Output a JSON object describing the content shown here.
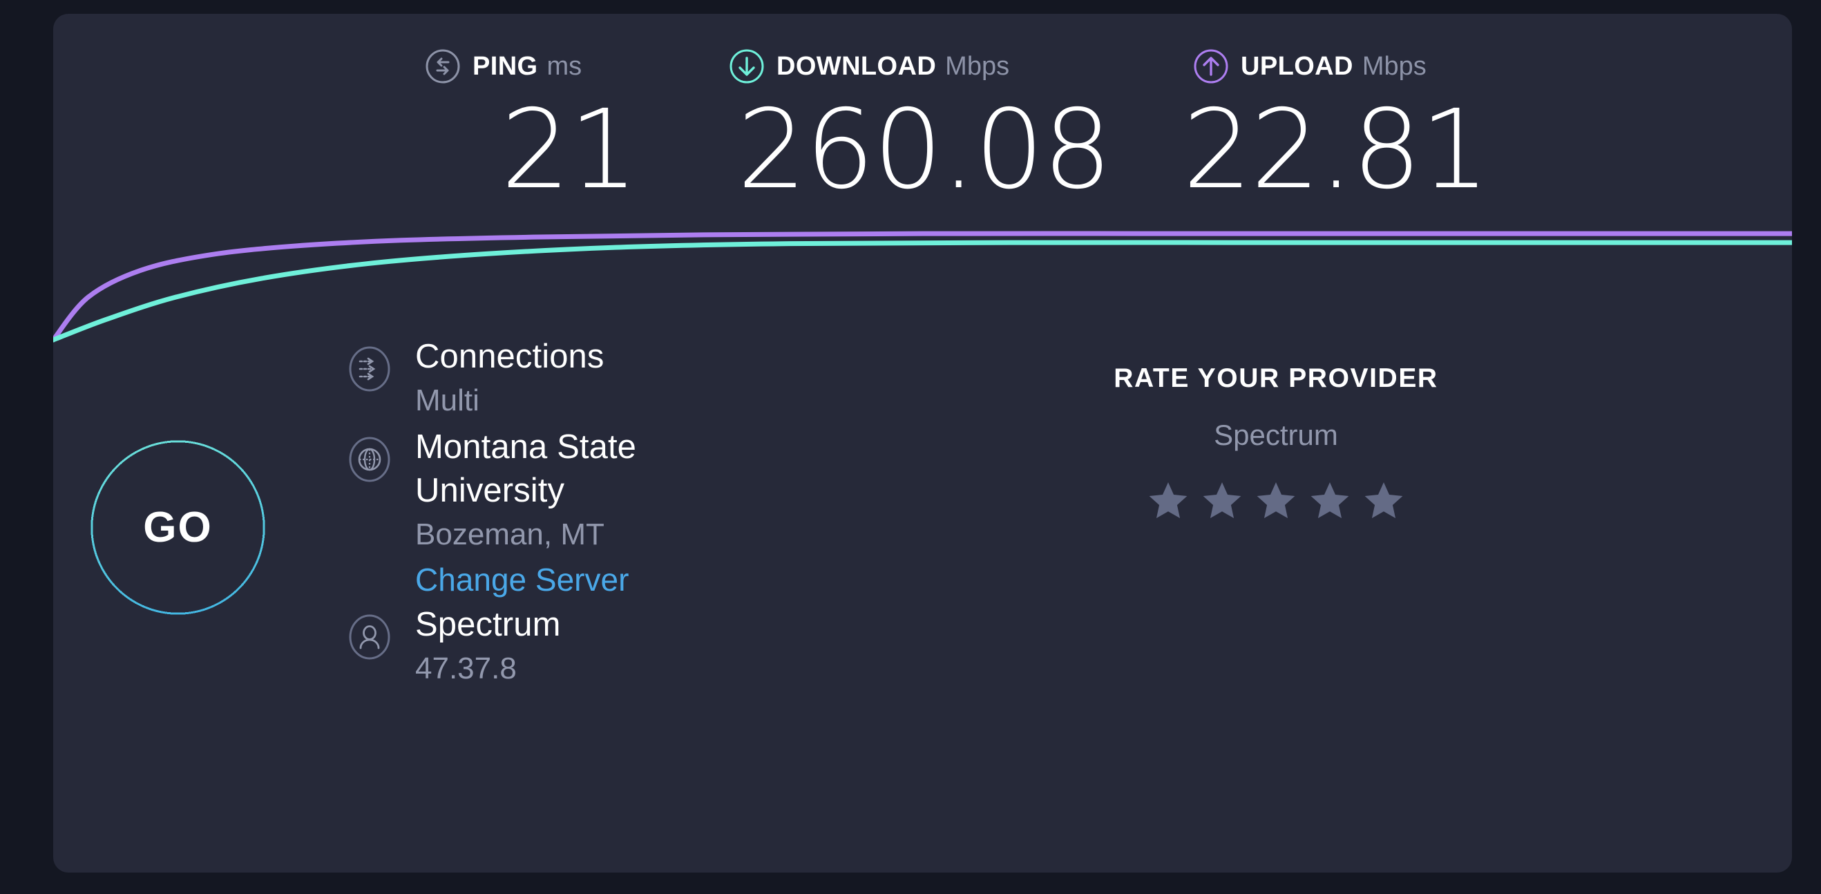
{
  "metrics": [
    {
      "id": "ping",
      "icon": "ping-icon",
      "label": "PING",
      "unit": "ms",
      "value": "21",
      "accent": "#8d93a8"
    },
    {
      "id": "download",
      "icon": "download-icon",
      "label": "DOWNLOAD",
      "unit": "Mbps",
      "value": "260.08",
      "accent": "#6ff0da"
    },
    {
      "id": "upload",
      "icon": "upload-icon",
      "label": "UPLOAD",
      "unit": "Mbps",
      "value": "22.81",
      "accent": "#ad7ef0"
    }
  ],
  "go_button": {
    "label": "GO"
  },
  "info": {
    "connections": {
      "icon": "connections-icon",
      "primary": "Connections",
      "secondary": "Multi"
    },
    "server": {
      "icon": "globe-icon",
      "primary_line1": "Montana State",
      "primary_line2": "University",
      "secondary": "Bozeman, MT",
      "change_link": "Change Server"
    },
    "isp": {
      "icon": "person-icon",
      "primary": "Spectrum",
      "secondary": "47.37.8"
    }
  },
  "rating": {
    "title": "RATE YOUR PROVIDER",
    "provider": "Spectrum",
    "stars_total": 5,
    "stars_filled": 0,
    "star_color": "#646b86"
  },
  "chart_data": {
    "type": "line",
    "title": "",
    "xlabel": "",
    "ylabel": "",
    "series": [
      {
        "name": "upload",
        "color": "#ad7ef0",
        "points": [
          [
            0,
            0
          ],
          [
            2,
            38
          ],
          [
            5,
            62
          ],
          [
            9,
            76
          ],
          [
            14,
            84
          ],
          [
            20,
            89
          ],
          [
            28,
            92
          ],
          [
            38,
            94
          ],
          [
            50,
            95
          ],
          [
            65,
            95
          ],
          [
            80,
            95
          ],
          [
            100,
            95
          ]
        ]
      },
      {
        "name": "download",
        "color": "#6ff0da",
        "points": [
          [
            0,
            0
          ],
          [
            3,
            18
          ],
          [
            7,
            38
          ],
          [
            12,
            55
          ],
          [
            18,
            68
          ],
          [
            25,
            77
          ],
          [
            33,
            83
          ],
          [
            42,
            86
          ],
          [
            55,
            87
          ],
          [
            70,
            87
          ],
          [
            85,
            87
          ],
          [
            100,
            87
          ]
        ]
      }
    ],
    "grid": false,
    "legend": "none",
    "xlim": [
      0,
      100
    ],
    "ylim": [
      0,
      100
    ]
  }
}
